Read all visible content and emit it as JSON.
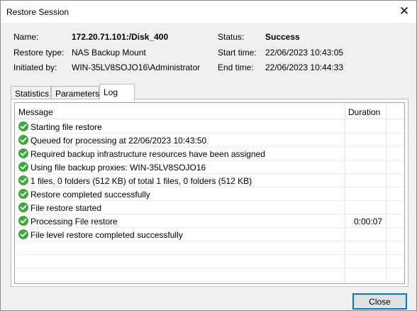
{
  "window": {
    "title": "Restore Session",
    "close_glyph": "✕"
  },
  "info": {
    "name_label": "Name:",
    "name_value": "172.20.71.101:/Disk_400",
    "type_label": "Restore type:",
    "type_value": "NAS Backup Mount",
    "initiated_label": "Initiated by:",
    "initiated_value": "WIN-35LV8SOJO16\\Administrator",
    "status_label": "Status:",
    "status_value": "Success",
    "start_label": "Start time:",
    "start_value": "22/06/2023 10:43:05",
    "end_label": "End time:",
    "end_value": "22/06/2023 10:44:33"
  },
  "tabs": [
    {
      "label": "Statistics"
    },
    {
      "label": "Parameters"
    },
    {
      "label": "Log"
    }
  ],
  "active_tab": "Log",
  "log": {
    "columns": {
      "message": "Message",
      "duration": "Duration"
    },
    "rows": [
      {
        "message": "Starting file restore",
        "duration": ""
      },
      {
        "message": "Queued for processing at 22/06/2023 10:43:50",
        "duration": ""
      },
      {
        "message": "Required backup infrastructure resources have been assigned",
        "duration": ""
      },
      {
        "message": "Using file backup proxies: WIN-35LV8SOJO16",
        "duration": ""
      },
      {
        "message": "1 files, 0 folders (512 KB) of total 1 files, 0 folders (512 KB)",
        "duration": ""
      },
      {
        "message": "Restore completed successfully",
        "duration": ""
      },
      {
        "message": "File restore started",
        "duration": ""
      },
      {
        "message": "Processing File restore",
        "duration": "0:00:07"
      },
      {
        "message": "File level restore completed successfully",
        "duration": ""
      }
    ],
    "status_icon": "success-check-icon",
    "success_color": "#3ea83e"
  },
  "buttons": {
    "close_label": "Close"
  }
}
